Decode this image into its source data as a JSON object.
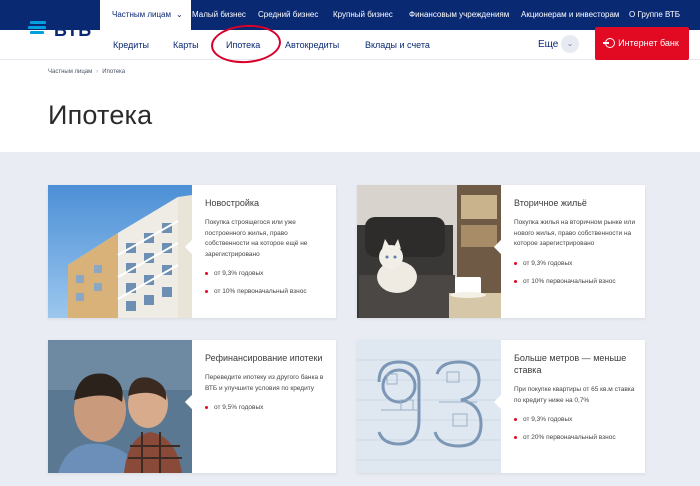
{
  "topbar": {
    "items": [
      {
        "label": "Частным лицам",
        "active": true
      },
      {
        "label": "Малый бизнес"
      },
      {
        "label": "Средний бизнес"
      },
      {
        "label": "Крупный бизнес"
      },
      {
        "label": "Финансовым учреждениям"
      },
      {
        "label": "Акционерам и инвесторам"
      },
      {
        "label": "О Группе ВТБ"
      }
    ],
    "chevron": "chevron-down-icon"
  },
  "logo": {
    "text": "ВТБ"
  },
  "nav": {
    "items": [
      {
        "label": "Кредиты"
      },
      {
        "label": "Карты"
      },
      {
        "label": "Ипотека",
        "current": true
      },
      {
        "label": "Автокредиты"
      },
      {
        "label": "Вклады и счета"
      }
    ],
    "more": "Еще",
    "internet_bank": "Интернет банк"
  },
  "breadcrumb": {
    "items": [
      "Частным лицам",
      "Ипотека"
    ]
  },
  "page": {
    "title": "Ипотека"
  },
  "cards": [
    {
      "title": "Новостройка",
      "description": "Покупка строящегося или уже построенного жилья, право собственности на которое ещё не зарегистрировано",
      "bullets": [
        "от 9,3% годовых",
        "от 10% первоначальный взнос"
      ],
      "image": "apartment-building-photo"
    },
    {
      "title": "Вторичное жильё",
      "description": "Покупка жилья на вторичном рынке или нового жилья, право собственности на которое зарегистрировано",
      "bullets": [
        "от 9,3% годовых",
        "от 10% первоначальный взнос"
      ],
      "image": "cat-on-armchair-photo"
    },
    {
      "title": "Рефинансирование ипотеки",
      "description": "Переведите ипотеку из другого банка в ВТБ и улучшите условия по кредиту",
      "bullets": [
        "от 9,5% годовых"
      ],
      "image": "father-and-son-photo"
    },
    {
      "title": "Больше метров — меньше ставка",
      "description": "При покупке квартиры от 65 кв.м ставка по кредиту ниже на 0,7%",
      "bullets": [
        "от 9,3% годовых",
        "от 20% первоначальный взнос"
      ],
      "image": "floor-plan-93-illustration"
    }
  ],
  "colors": {
    "brand_dark": "#0a2973",
    "brand_light": "#009fdf",
    "accent_red": "#e10a22",
    "bg_grey": "#e9edf3"
  }
}
